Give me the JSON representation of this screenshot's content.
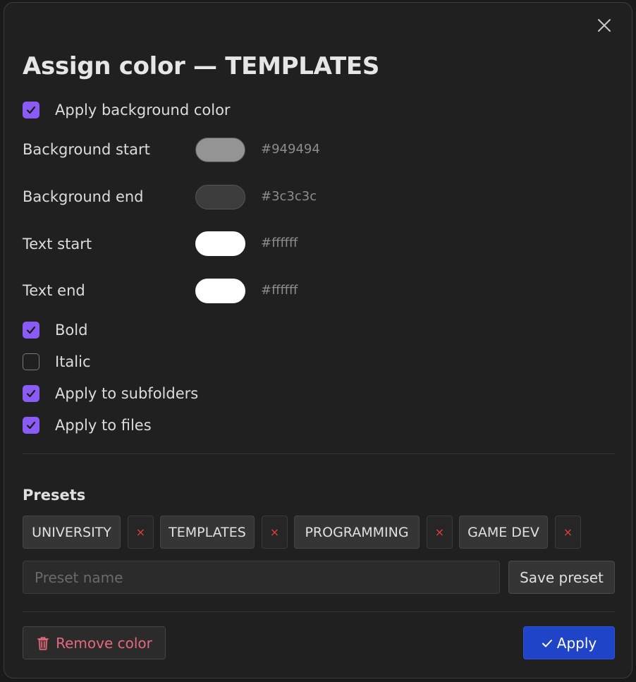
{
  "dialog": {
    "title": "Assign color — TEMPLATES"
  },
  "options": {
    "apply_background": {
      "label": "Apply background color",
      "checked": true
    },
    "bold": {
      "label": "Bold",
      "checked": true
    },
    "italic": {
      "label": "Italic",
      "checked": false
    },
    "apply_subfolders": {
      "label": "Apply to subfolders",
      "checked": true
    },
    "apply_files": {
      "label": "Apply to files",
      "checked": true
    }
  },
  "colors": {
    "background_start": {
      "label": "Background start",
      "hex": "#949494"
    },
    "background_end": {
      "label": "Background end",
      "hex": "#3c3c3c"
    },
    "text_start": {
      "label": "Text start",
      "hex": "#ffffff"
    },
    "text_end": {
      "label": "Text end",
      "hex": "#ffffff"
    }
  },
  "presets": {
    "title": "Presets",
    "items": [
      {
        "name": "UNIVERSITY"
      },
      {
        "name": "TEMPLATES"
      },
      {
        "name": "PROGRAMMING"
      },
      {
        "name": "GAME DEV"
      }
    ],
    "delete_glyph": "×",
    "name_placeholder": "Preset name",
    "name_value": "",
    "save_label": "Save preset"
  },
  "actions": {
    "remove_label": "Remove color",
    "apply_label": "Apply"
  },
  "theme": {
    "accent_checkbox": "#8a5cf5",
    "apply_button": "#1f44c8",
    "remove_text": "#e5697d",
    "delete_x": "#e04040"
  },
  "icons": {
    "close": "close-icon",
    "check": "check-icon",
    "trash": "trash-icon"
  }
}
